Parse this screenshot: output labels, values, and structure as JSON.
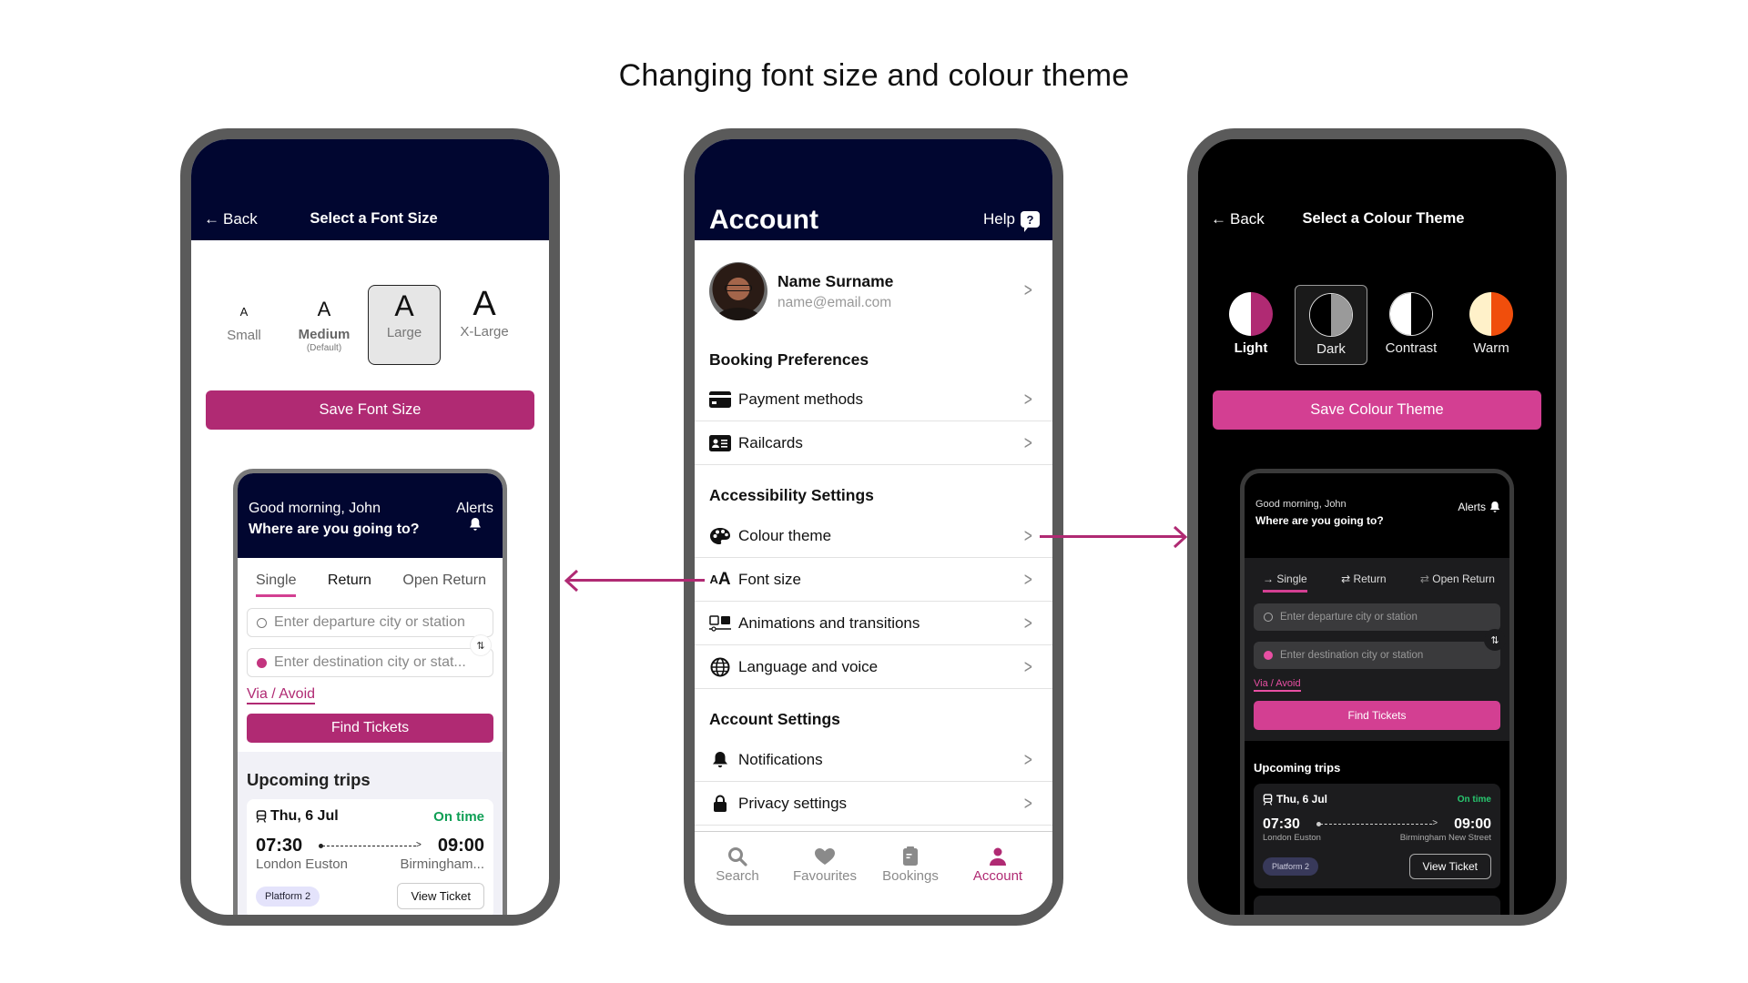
{
  "page_title": "Changing font size and colour theme",
  "colors": {
    "navy": "#010630",
    "magenta": "#b02a73",
    "pink": "#d33f92",
    "on_time_green": "#0f9f55",
    "frame_grey": "#5a5a5a"
  },
  "font_size_screen": {
    "back_label": "Back",
    "title": "Select a Font Size",
    "options": [
      {
        "glyph": "A",
        "label": "Small",
        "sub": ""
      },
      {
        "glyph": "A",
        "label": "Medium",
        "sub": "(Default)"
      },
      {
        "glyph": "A",
        "label": "Large",
        "sub": ""
      },
      {
        "glyph": "A",
        "label": "X-Large",
        "sub": ""
      }
    ],
    "selected": "Large",
    "save_label": "Save Font Size",
    "preview": {
      "greeting": "Good morning, John",
      "question": "Where are you going to?",
      "alerts_label": "Alerts",
      "tabs": [
        "Single",
        "Return",
        "Open Return"
      ],
      "active_tab": "Single",
      "departure_placeholder": "Enter departure city or station",
      "destination_placeholder": "Enter destination city or stat...",
      "via_label": "Via / Avoid",
      "find_label": "Find Tickets",
      "upcoming_title": "Upcoming trips",
      "trip": {
        "date": "Thu, 6 Jul",
        "status": "On time",
        "depart_time": "07:30",
        "arrive_time": "09:00",
        "from": "London Euston",
        "to": "Birmingham...",
        "platform": "Platform 2",
        "view_label": "View Ticket"
      }
    }
  },
  "account_screen": {
    "title": "Account",
    "help_label": "Help",
    "profile": {
      "name": "Name Surname",
      "email": "name@email.com"
    },
    "sections": [
      {
        "heading": "Booking Preferences",
        "items": [
          {
            "icon": "credit-card-icon",
            "label": "Payment methods"
          },
          {
            "icon": "id-card-icon",
            "label": "Railcards"
          }
        ]
      },
      {
        "heading": "Accessibility Settings",
        "items": [
          {
            "icon": "palette-icon",
            "label": "Colour theme"
          },
          {
            "icon": "font-size-icon",
            "label": "Font size"
          },
          {
            "icon": "animation-icon",
            "label": "Animations and transitions"
          },
          {
            "icon": "globe-icon",
            "label": "Language and voice"
          }
        ]
      },
      {
        "heading": "Account Settings",
        "items": [
          {
            "icon": "bell-icon",
            "label": "Notifications"
          },
          {
            "icon": "lock-icon",
            "label": "Privacy settings"
          }
        ]
      }
    ],
    "nav": [
      {
        "icon": "search-icon",
        "label": "Search"
      },
      {
        "icon": "heart-icon",
        "label": "Favourites"
      },
      {
        "icon": "bookings-icon",
        "label": "Bookings"
      },
      {
        "icon": "account-icon",
        "label": "Account"
      }
    ],
    "active_nav": "Account"
  },
  "colour_theme_screen": {
    "back_label": "Back",
    "title": "Select a Colour Theme",
    "options": [
      {
        "label": "Light",
        "left": "#ffffff",
        "right": "#b02a73"
      },
      {
        "label": "Dark",
        "left": "#000000",
        "right": "#9a9a9a"
      },
      {
        "label": "Contrast",
        "left": "#ffffff",
        "right": "#000000"
      },
      {
        "label": "Warm",
        "left": "#fff1c9",
        "right": "#f04e0c"
      }
    ],
    "selected": "Dark",
    "save_label": "Save Colour Theme",
    "preview": {
      "greeting": "Good morning, John",
      "question": "Where are you going to?",
      "alerts_label": "Alerts",
      "tabs": [
        "Single",
        "Return",
        "Open Return"
      ],
      "active_tab": "Single",
      "departure_placeholder": "Enter departure city or station",
      "destination_placeholder": "Enter destination city or station",
      "via_label": "Via / Avoid",
      "find_label": "Find Tickets",
      "upcoming_title": "Upcoming trips",
      "trip": {
        "date": "Thu, 6 Jul",
        "status": "On time",
        "depart_time": "07:30",
        "arrive_time": "09:00",
        "from": "London Euston",
        "to": "Birmingham New Street",
        "platform": "Platform 2",
        "view_label": "View Ticket"
      }
    }
  }
}
